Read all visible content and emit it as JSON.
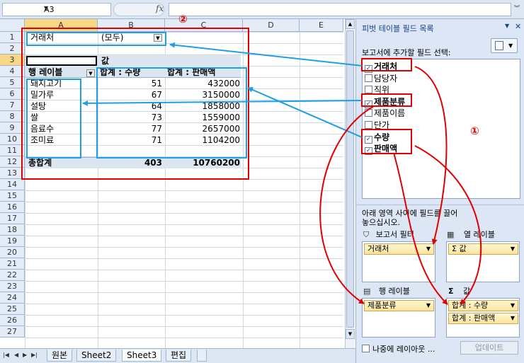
{
  "formula_bar": {
    "name_box": "A3",
    "fx": "fx",
    "value": ""
  },
  "columns": [
    "A",
    "B",
    "C",
    "D",
    "E"
  ],
  "rows": [
    "1",
    "2",
    "3",
    "4",
    "5",
    "6",
    "7",
    "8",
    "9",
    "10",
    "11",
    "12",
    "13",
    "14",
    "15",
    "16",
    "17",
    "18",
    "19",
    "20",
    "21",
    "22",
    "23",
    "24",
    "25",
    "26",
    "27"
  ],
  "pivot_table": {
    "filter_field": "거래처",
    "filter_value": "(모두)",
    "values_label": "값",
    "row_label_header": "행 레이블",
    "col_headers": [
      "합계 : 수량",
      "합계 : 판매액"
    ],
    "rows": [
      {
        "label": "돼지고기",
        "qty": "51",
        "sales": "432000"
      },
      {
        "label": "밀가루",
        "qty": "67",
        "sales": "3150000"
      },
      {
        "label": "설탕",
        "qty": "64",
        "sales": "1858000"
      },
      {
        "label": "쌀",
        "qty": "73",
        "sales": "1559000"
      },
      {
        "label": "음료수",
        "qty": "77",
        "sales": "2657000"
      },
      {
        "label": "조미료",
        "qty": "71",
        "sales": "1104200"
      }
    ],
    "total": {
      "label": "총합계",
      "qty": "403",
      "sales": "10760200"
    }
  },
  "sheet_tabs": [
    "원본",
    "Sheet2",
    "Sheet3",
    "편집"
  ],
  "active_sheet": "Sheet3",
  "panel": {
    "title": "피벗 테이블 필드 목록",
    "choose_fields": "보고서에 추가할 필드 선택:",
    "fields": [
      {
        "name": "거래처",
        "checked": true
      },
      {
        "name": "담당자",
        "checked": false
      },
      {
        "name": "직위",
        "checked": false
      },
      {
        "name": "제품분류",
        "checked": true
      },
      {
        "name": "제품이름",
        "checked": false
      },
      {
        "name": "단가",
        "checked": false
      },
      {
        "name": "수량",
        "checked": true
      },
      {
        "name": "판매액",
        "checked": true
      }
    ],
    "drag_hint_1": "아래 영역 사이에 필드를 끌어",
    "drag_hint_2": "놓으십시오.",
    "report_filter_label": "보고서 필터",
    "column_labels_label": "열 레이블",
    "row_labels_label": "행 레이블",
    "values_label": "값",
    "report_filter_items": [
      "거래처"
    ],
    "column_items": [
      "Σ 값"
    ],
    "row_items": [
      "제품분류"
    ],
    "value_items": [
      "합계 : 수량",
      "합계 : 판매액"
    ],
    "defer_label": "나중에 레이아웃 ...",
    "update_button": "업데이트"
  },
  "annotations": {
    "circle_1": "①",
    "circle_2": "②",
    "color": "#e00000",
    "blue": "#1e9fe6"
  }
}
